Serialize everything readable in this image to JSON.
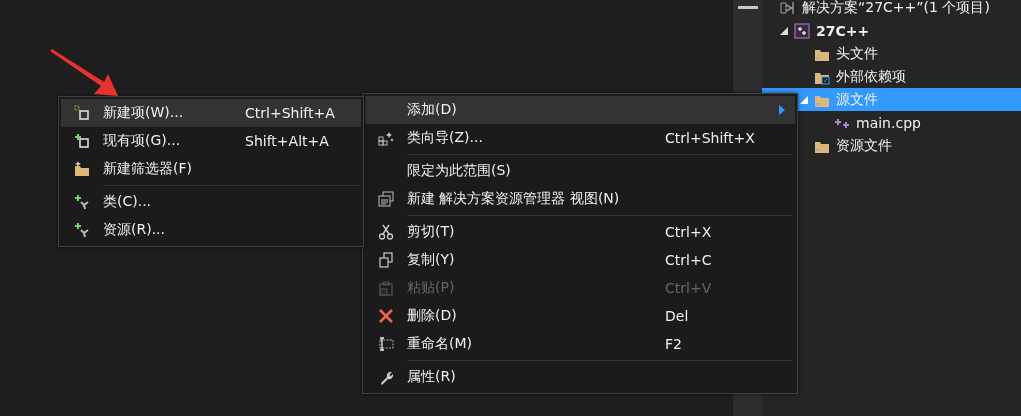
{
  "solution_explorer": {
    "tree": [
      {
        "label": "解决方案“27C++”(1 个项目)",
        "selected": false,
        "children": [
          {
            "label": "27C++",
            "selected": false,
            "expanded": true,
            "children": [
              {
                "label": "头文件",
                "selected": false
              },
              {
                "label": "外部依赖项",
                "selected": false
              },
              {
                "label": "源文件",
                "selected": true,
                "expanded": true,
                "children": [
                  {
                    "label": "main.cpp",
                    "selected": false
                  }
                ]
              },
              {
                "label": "资源文件",
                "selected": false
              }
            ]
          }
        ]
      }
    ]
  },
  "context_menu": {
    "items": [
      {
        "kind": "item",
        "label": "添加(D)",
        "selected": true,
        "disabled": false,
        "submenu": true
      },
      {
        "kind": "item",
        "label": "类向导(Z)...",
        "shortcut": "Ctrl+Shift+X",
        "selected": false,
        "disabled": false,
        "submenu": false
      },
      {
        "kind": "separator"
      },
      {
        "kind": "item",
        "label": "限定为此范围(S)",
        "selected": false,
        "disabled": false,
        "submenu": false
      },
      {
        "kind": "item",
        "label": "新建 解决方案资源管理器 视图(N)",
        "selected": false,
        "disabled": false,
        "submenu": false
      },
      {
        "kind": "separator"
      },
      {
        "kind": "item",
        "label": "剪切(T)",
        "shortcut": "Ctrl+X",
        "selected": false,
        "disabled": false,
        "submenu": false
      },
      {
        "kind": "item",
        "label": "复制(Y)",
        "shortcut": "Ctrl+C",
        "selected": false,
        "disabled": false,
        "submenu": false
      },
      {
        "kind": "item",
        "label": "粘贴(P)",
        "shortcut": "Ctrl+V",
        "selected": false,
        "disabled": true,
        "submenu": false
      },
      {
        "kind": "item",
        "label": "删除(D)",
        "shortcut": "Del",
        "selected": false,
        "disabled": false,
        "submenu": false
      },
      {
        "kind": "item",
        "label": "重命名(M)",
        "shortcut": "F2",
        "selected": false,
        "disabled": false,
        "submenu": false
      },
      {
        "kind": "separator"
      },
      {
        "kind": "item",
        "label": "属性(R)",
        "selected": false,
        "disabled": false,
        "submenu": false
      }
    ]
  },
  "add_submenu": {
    "items": [
      {
        "kind": "item",
        "label": "新建项(W)...",
        "shortcut": "Ctrl+Shift+A",
        "selected": true,
        "disabled": false
      },
      {
        "kind": "item",
        "label": "现有项(G)...",
        "shortcut": "Shift+Alt+A",
        "selected": false,
        "disabled": false
      },
      {
        "kind": "item",
        "label": "新建筛选器(F)",
        "selected": false,
        "disabled": false
      },
      {
        "kind": "separator"
      },
      {
        "kind": "item",
        "label": "类(C)...",
        "selected": false,
        "disabled": false
      },
      {
        "kind": "item",
        "label": "资源(R)...",
        "selected": false,
        "disabled": false
      }
    ]
  }
}
